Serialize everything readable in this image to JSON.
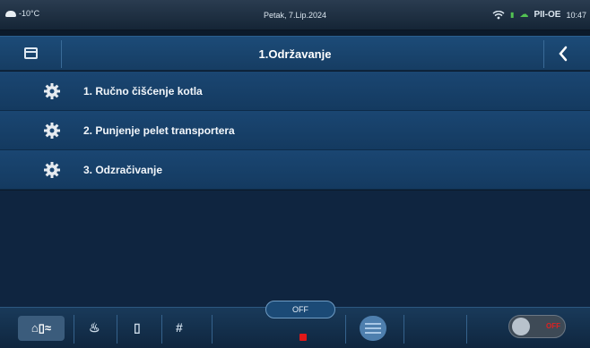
{
  "status": {
    "temperature": "-10°C",
    "date": "Petak, 7.Lip.2024",
    "mode": "PII-OE",
    "time": "10:47"
  },
  "header": {
    "title": "1.Održavanje"
  },
  "menu": {
    "items": [
      {
        "label": "1.  Ručno čišćenje kotla"
      },
      {
        "label": "2.  Punjenje pelet transportera"
      },
      {
        "label": "3.  Odzračivanje"
      }
    ]
  },
  "bottom": {
    "off_label": "OFF",
    "toggle_label": "OFF"
  },
  "colors": {
    "accent": "#1c4b78",
    "alert": "#e01818"
  }
}
